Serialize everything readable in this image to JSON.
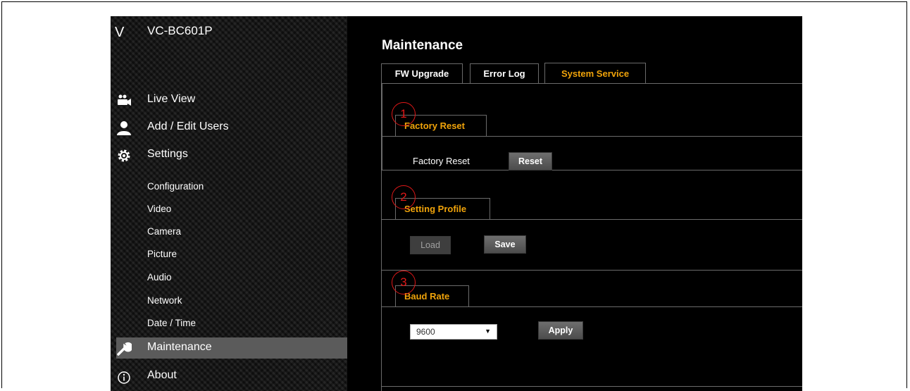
{
  "app": {
    "logo": "V",
    "model": "VC-BC601P"
  },
  "nav": {
    "live_view": "Live View",
    "add_edit_users": "Add / Edit Users",
    "settings": "Settings",
    "sub_items": [
      "Configuration",
      "Video",
      "Camera",
      "Picture",
      "Audio",
      "Network",
      "Date / Time"
    ],
    "maintenance": "Maintenance",
    "about": "About"
  },
  "page": {
    "title": "Maintenance",
    "tabs": [
      "FW Upgrade",
      "Error Log",
      "System Service"
    ],
    "active_tab": "System Service"
  },
  "sections": {
    "factory_reset": {
      "marker": "1",
      "heading": "Factory Reset",
      "field_label": "Factory Reset",
      "button": "Reset"
    },
    "setting_profile": {
      "marker": "2",
      "heading": "Setting Profile",
      "load_button": "Load",
      "save_button": "Save"
    },
    "baud_rate": {
      "marker": "3",
      "heading": "Baud Rate",
      "selected_value": "9600",
      "apply_button": "Apply"
    }
  },
  "colors": {
    "accent": "#f0a30a",
    "marker": "#e01818",
    "active_nav": "#5b5b5b"
  }
}
